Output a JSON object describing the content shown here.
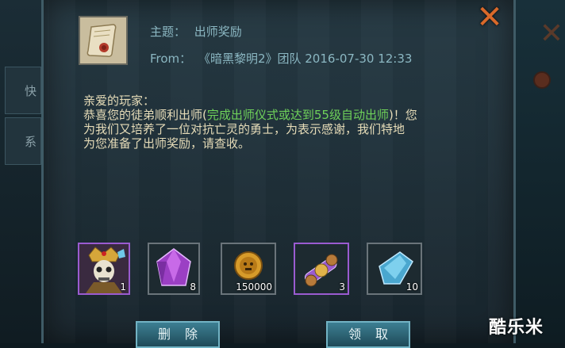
{
  "background": {
    "left_tabs": [
      "快",
      "系"
    ]
  },
  "mail": {
    "subject_label": "主题：",
    "subject": "出师奖励",
    "from_label": "From：",
    "from": "《暗黑黎明2》团队 2016-07-30 12:33",
    "greeting": "亲爱的玩家：",
    "line1_pre": "恭喜您的徒弟顺利出师(",
    "line1_highlight": "完成出师仪式或达到55级自动出师",
    "line1_post": ")！您",
    "line2": "为我们又培养了一位对抗亡灵的勇士，为表示感谢，我们特地",
    "line3": "为您准备了出师奖励，请查收。"
  },
  "rewards": [
    {
      "icon": "skeleton-hero-icon",
      "count": "1"
    },
    {
      "icon": "purple-gem-icon",
      "count": "8"
    },
    {
      "icon": "gold-coin-icon",
      "count": "150000"
    },
    {
      "icon": "purple-scroll-icon",
      "count": "3"
    },
    {
      "icon": "blue-crystal-icon",
      "count": "10"
    }
  ],
  "buttons": {
    "delete": "删除",
    "claim": "领取"
  },
  "watermark": "酷乐米",
  "colors": {
    "highlight_green": "#6fd25a",
    "body_text": "#e6dcb8",
    "header_text": "#8bb7c2",
    "close_orange": "#d9692a"
  }
}
